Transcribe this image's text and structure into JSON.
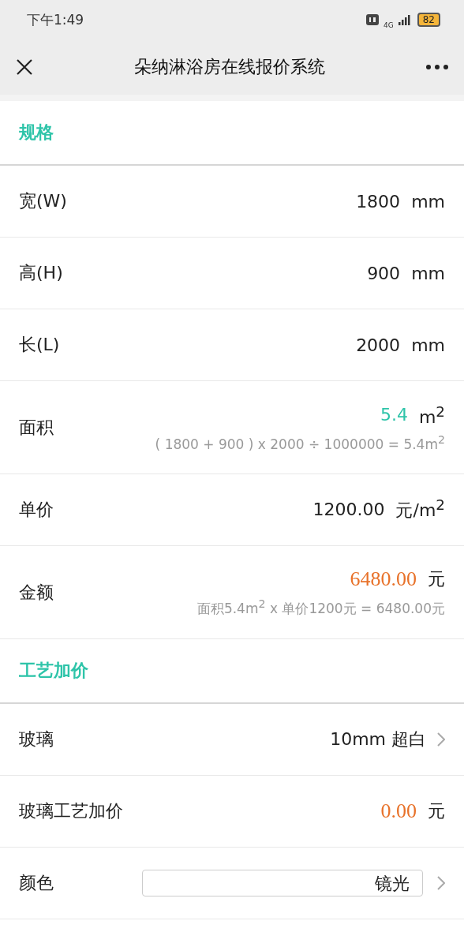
{
  "status_bar": {
    "time": "下午1:49",
    "network": "4G",
    "battery": "82"
  },
  "nav": {
    "title": "朵纳淋浴房在线报价系统"
  },
  "sections": [
    {
      "title": "规格",
      "rows": [
        {
          "kind": "input",
          "label": "宽(W)",
          "value": "1800",
          "unit": "mm"
        },
        {
          "kind": "input",
          "label": "高(H)",
          "value": "900",
          "unit": "mm"
        },
        {
          "kind": "input",
          "label": "长(L)",
          "value": "2000",
          "unit": "mm"
        },
        {
          "kind": "area",
          "label": "面积",
          "value": "5.4",
          "unit": "m$^{2}$",
          "formula": "( 1800 + 900 ) x 2000 ÷ 1000000 = 5.4m$^{2}$"
        },
        {
          "kind": "input",
          "label": "单价",
          "value": "1200.00",
          "unit": "元/m$^{2}$"
        },
        {
          "kind": "price",
          "label": "金额",
          "value": "6480.00",
          "unit": "元",
          "formula": "面积5.4m$^{2}$ x 单价1200元 = 6480.00元"
        }
      ]
    },
    {
      "title": "工艺加价",
      "rows": [
        {
          "kind": "select",
          "label": "玻璃",
          "value": "10mm 超白"
        },
        {
          "kind": "price",
          "label": "玻璃工艺加价",
          "value": "0.00",
          "unit": "元"
        },
        {
          "kind": "field-select",
          "label": "颜色",
          "value": "镜光"
        }
      ]
    }
  ]
}
